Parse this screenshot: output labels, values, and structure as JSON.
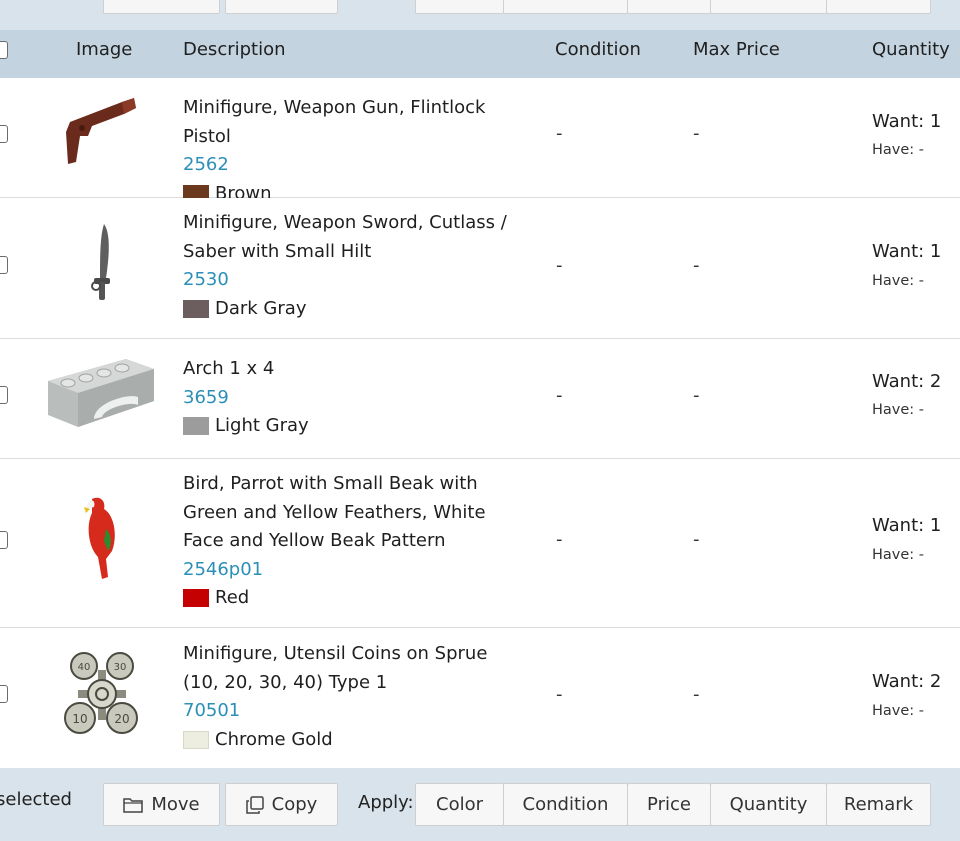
{
  "table": {
    "headers": {
      "image": "Image",
      "description": "Description",
      "condition": "Condition",
      "max_price": "Max Price",
      "quantity": "Quantity"
    },
    "rows": [
      {
        "description": "Minifigure, Weapon Gun, Flintlock Pistol",
        "item_no": "2562",
        "color_name": "Brown",
        "color_hex": "#6b3a1e",
        "condition": "-",
        "max_price": "-",
        "want": "Want: 1",
        "have": "Have: -",
        "image_icon": "flintlock-pistol-icon"
      },
      {
        "description": "Minifigure, Weapon Sword, Cutlass / Saber with Small Hilt",
        "item_no": "2530",
        "color_name": "Dark Gray",
        "color_hex": "#6c5e5e",
        "condition": "-",
        "max_price": "-",
        "want": "Want: 1",
        "have": "Have: -",
        "image_icon": "cutlass-sword-icon"
      },
      {
        "description": "Arch 1 x 4",
        "item_no": "3659",
        "color_name": "Light Gray",
        "color_hex": "#9c9c9c",
        "condition": "-",
        "max_price": "-",
        "want": "Want: 2",
        "have": "Have: -",
        "image_icon": "arch-brick-icon"
      },
      {
        "description": "Bird, Parrot with Small Beak with Green and Yellow Feathers, White Face and Yellow Beak Pattern",
        "item_no": "2546p01",
        "color_name": "Red",
        "color_hex": "#c40000",
        "condition": "-",
        "max_price": "-",
        "want": "Want: 1",
        "have": "Have: -",
        "image_icon": "parrot-icon"
      },
      {
        "description": "Minifigure, Utensil Coins on Sprue (10, 20, 30, 40) Type 1",
        "item_no": "70501",
        "color_name": "Chrome Gold",
        "color_hex": "#eeeee0",
        "condition": "-",
        "max_price": "-",
        "want": "Want: 2",
        "have": "Have: -",
        "image_icon": "coins-sprue-icon",
        "coin_labels": [
          "10",
          "20",
          "30",
          "40"
        ]
      }
    ]
  },
  "footer": {
    "selected_text": "selected",
    "move_label": "Move",
    "copy_label": "Copy",
    "apply_label": "Apply:",
    "color_label": "Color",
    "condition_label": "Condition",
    "price_label": "Price",
    "quantity_label": "Quantity",
    "remark_label": "Remark"
  },
  "colors": {
    "link": "#2b8fb8",
    "header_bg": "#c3d3df",
    "toolbar_bg": "#d9e3eb"
  }
}
